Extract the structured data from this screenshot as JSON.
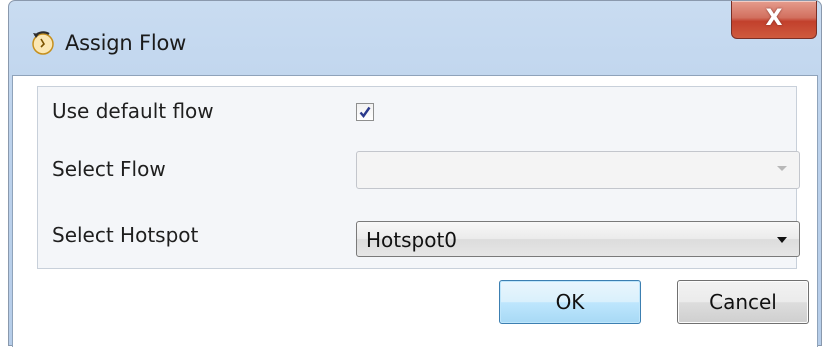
{
  "window": {
    "title": "Assign Flow",
    "icon": "flow-icon",
    "close_label": "X"
  },
  "form": {
    "use_default_flow": {
      "label": "Use default flow",
      "checked": true
    },
    "select_flow": {
      "label": "Select Flow",
      "value": "",
      "enabled": false
    },
    "select_hotspot": {
      "label": "Select Hotspot",
      "value": "Hotspot0"
    }
  },
  "buttons": {
    "ok_label": "OK",
    "cancel_label": "Cancel"
  }
}
